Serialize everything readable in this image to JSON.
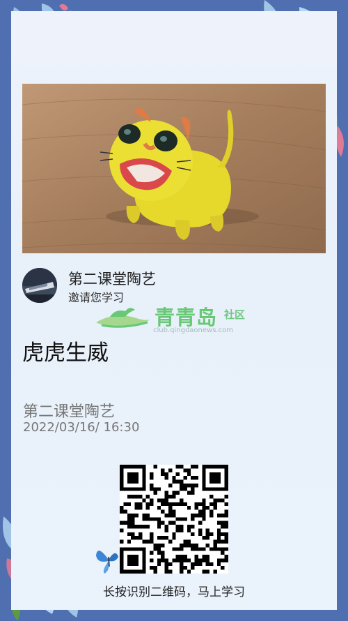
{
  "post": {
    "author_name": "第二课堂陶艺",
    "invite_text": "邀请您学习",
    "title": "虎虎生威",
    "meta_name": "第二课堂陶艺",
    "date": "2022/03/16/ 16:30"
  },
  "watermark": {
    "brand": "青青岛",
    "community": "社区",
    "url": "club.qingdaonews.com"
  },
  "qr": {
    "caption": "长按识别二维码，马上学习"
  },
  "colors": {
    "border": "#4f6fb0",
    "card_bg": "#eef3fb",
    "brand_green": "#3dbb4b"
  }
}
